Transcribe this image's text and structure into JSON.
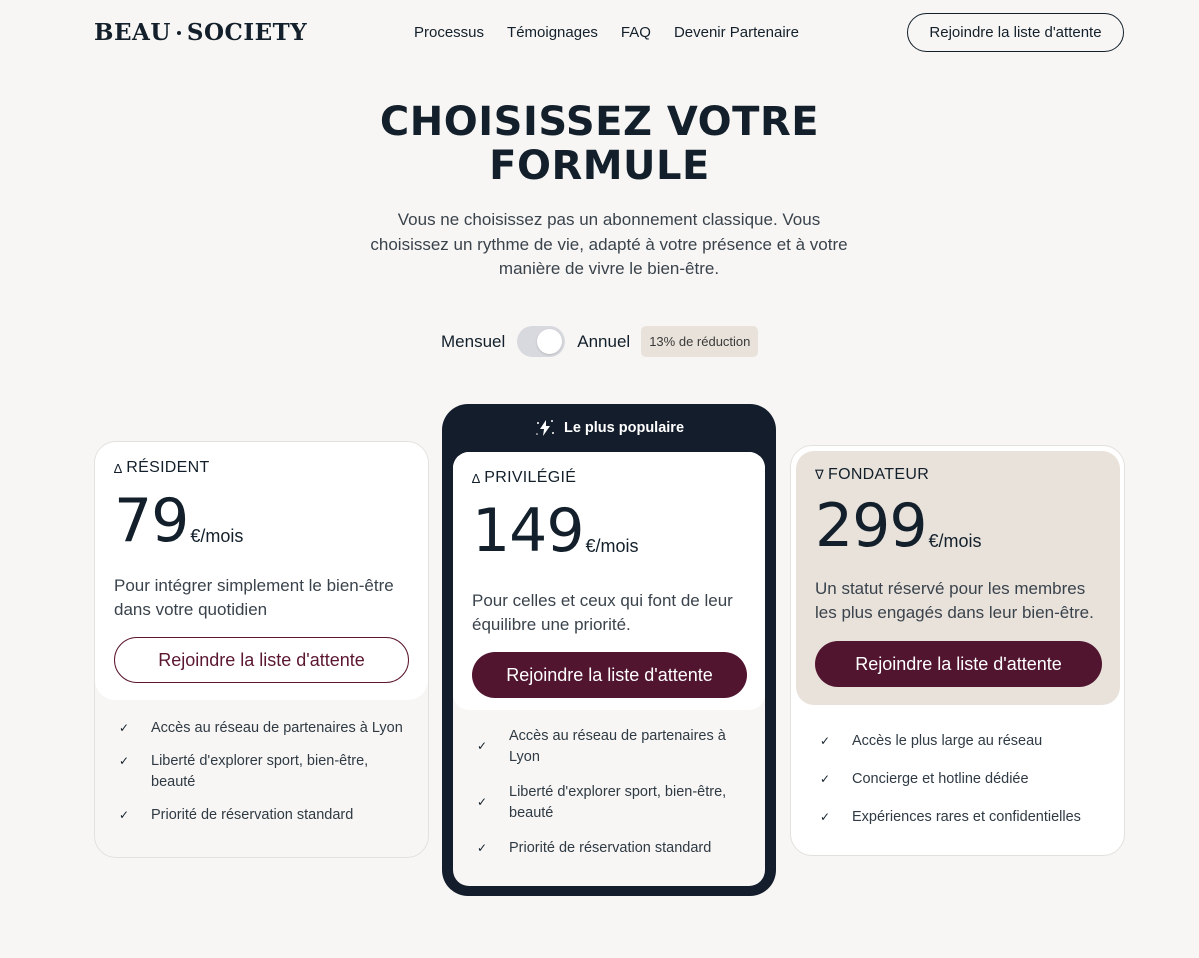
{
  "header": {
    "logo_left": "BEAU",
    "logo_right": "SOCIETY",
    "nav": [
      "Processus",
      "Témoignages",
      "FAQ",
      "Devenir Partenaire"
    ],
    "cta_label": "Rejoindre la liste d'attente"
  },
  "hero": {
    "title_line1": "CHOISISSEZ VOTRE",
    "title_line2": "FORMULE",
    "subtitle": "Vous ne choisissez pas un abonnement classique. Vous choisissez un rythme de vie, adapté à votre présence et à votre manière de vivre le bien-être."
  },
  "billing": {
    "monthly_label": "Mensuel",
    "yearly_label": "Annuel",
    "discount_label": "13% de réduction",
    "selected": "Annuel"
  },
  "plans": [
    {
      "name": "RÉSIDENT",
      "symbol": "∆",
      "price": "79",
      "unit": "€/mois",
      "description": "Pour intégrer simplement le bien-être dans votre quotidien",
      "cta_label": "Rejoindre la liste d'attente",
      "features": [
        "Accès au réseau de partenaires à Lyon",
        "Liberté d'explorer sport, bien-être, beauté",
        "Priorité de réservation standard"
      ]
    },
    {
      "badge": "Le plus populaire",
      "name": "PRIVILÉGIÉ",
      "symbol": "∆",
      "price": "149",
      "unit": "€/mois",
      "description": "Pour celles et ceux qui font de leur équilibre une priorité.",
      "cta_label": "Rejoindre la liste d'attente",
      "features": [
        "Accès au réseau de partenaires à Lyon",
        "Liberté d'explorer sport, bien-être, beauté",
        "Priorité de réservation standard"
      ]
    },
    {
      "name": "FONDATEUR",
      "symbol": "∇",
      "price": "299",
      "unit": "€/mois",
      "description": "Un statut réservé pour les membres les plus engagés dans leur bien-être.",
      "cta_label": "Rejoindre la liste d'attente",
      "features": [
        "Accès le plus large au réseau",
        "Concierge et hotline dédiée",
        "Expériences rares et confidentielles"
      ]
    }
  ],
  "colors": {
    "ink": "#13202b",
    "burgundy": "#521530",
    "background": "#f7f6f4",
    "navy_card": "#141d2b",
    "beige": "#e8e2db"
  }
}
